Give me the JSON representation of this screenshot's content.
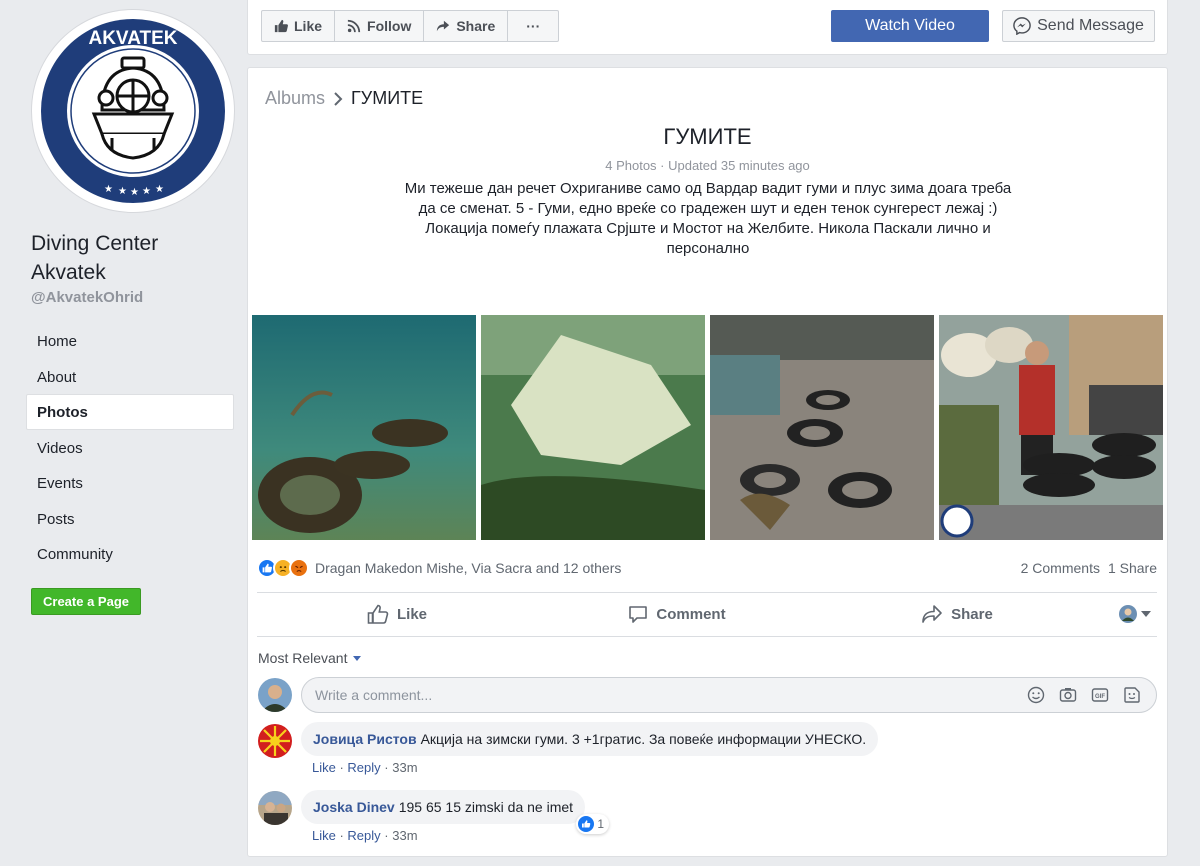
{
  "sidebar": {
    "logo_text": "AKVATEK",
    "page_name": "Diving Center Akvatek",
    "handle": "@AkvatekOhrid",
    "items": [
      {
        "label": "Home"
      },
      {
        "label": "About"
      },
      {
        "label": "Photos",
        "active": true
      },
      {
        "label": "Videos"
      },
      {
        "label": "Events"
      },
      {
        "label": "Posts"
      },
      {
        "label": "Community"
      }
    ],
    "create_page": "Create a Page"
  },
  "topbar": {
    "like": "Like",
    "follow": "Follow",
    "share": "Share",
    "more": "···",
    "watch_video": "Watch Video",
    "send_message": "Send Message"
  },
  "album": {
    "breadcrumb_root": "Albums",
    "breadcrumb_current": "ГУМИТЕ",
    "title": "ГУМИТЕ",
    "meta": "4 Photos · Updated 35 minutes ago",
    "description": "Ми тежеше дан речет Охриганиве само од Вардар вадит гуми и плус зима доага треба да се сменат. 5 - Гуми, едно вреќе со градежен шут и еден тенок сунгерест лежај :) Локација помеѓу плажата Срјште и Мостот на Желбите. Никола Паскали лично и персонално"
  },
  "reactions": {
    "people": "Dragan Makedon Mishe, Via Sacra and 12 others",
    "comments": "2 Comments",
    "shares": "1 Share"
  },
  "actions": {
    "like": "Like",
    "comment": "Comment",
    "share": "Share"
  },
  "comments_section": {
    "sort": "Most Relevant",
    "placeholder": "Write a comment...",
    "comments": [
      {
        "author": "Јовица Ристов",
        "text": "Акција на зимски гуми. 3 +1гратис. За повеќе информации УНЕСКО.",
        "like": "Like",
        "reply": "Reply",
        "time": "33m"
      },
      {
        "author": "Joska Dinev",
        "text": "195 65 15 zimski da ne imet",
        "like": "Like",
        "reply": "Reply",
        "time": "33m",
        "reaction_count": "1"
      }
    ]
  },
  "colors": {
    "fb_blue": "#4267b2",
    "link_blue": "#385898",
    "green": "#42b72a",
    "logo_navy": "#1f3d7a"
  }
}
